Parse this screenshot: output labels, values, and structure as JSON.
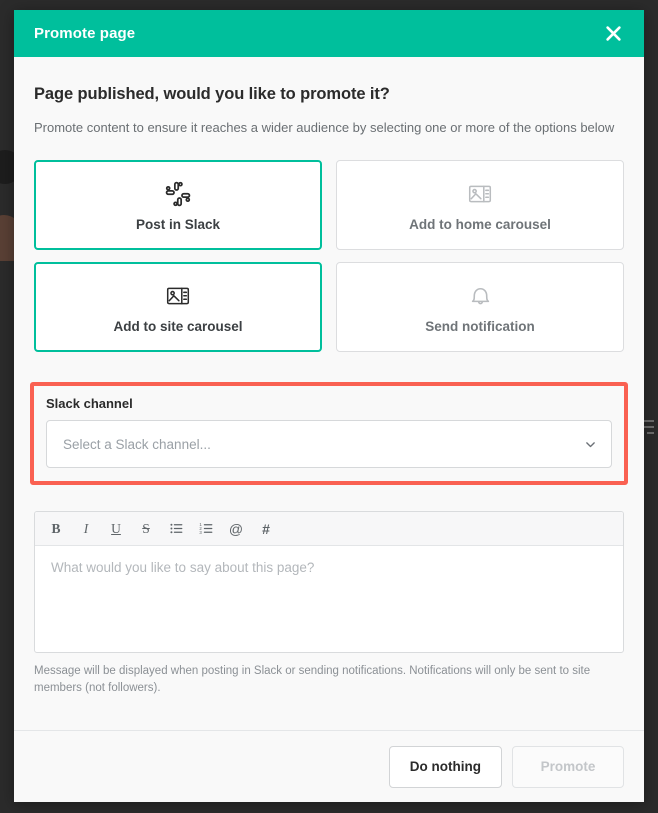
{
  "header": {
    "title": "Promote page",
    "close_icon": "close-icon"
  },
  "body": {
    "headline": "Page published, would you like to promote it?",
    "subtext": "Promote content to ensure it reaches a wider audience by selecting one or more of the options below"
  },
  "options": [
    {
      "label": "Post in Slack",
      "icon": "slack-icon",
      "selected": true
    },
    {
      "label": "Add to home carousel",
      "icon": "carousel-icon",
      "selected": false
    },
    {
      "label": "Add to site carousel",
      "icon": "carousel-icon",
      "selected": true
    },
    {
      "label": "Send notification",
      "icon": "bell-icon",
      "selected": false
    }
  ],
  "slack_channel": {
    "label": "Slack channel",
    "placeholder": "Select a Slack channel...",
    "chevron_icon": "chevron-down-icon",
    "highlight_color": "#fa6152"
  },
  "editor": {
    "placeholder": "What would you like to say about this page?",
    "toolbar": [
      {
        "name": "bold-icon",
        "glyph": "B"
      },
      {
        "name": "italic-icon",
        "glyph": "I"
      },
      {
        "name": "underline-icon",
        "glyph": "U"
      },
      {
        "name": "strikethrough-icon",
        "glyph": "S"
      },
      {
        "name": "bullet-list-icon",
        "glyph": ""
      },
      {
        "name": "numbered-list-icon",
        "glyph": ""
      },
      {
        "name": "mention-icon",
        "glyph": "@"
      },
      {
        "name": "hashtag-icon",
        "glyph": "#"
      }
    ],
    "helper_text": "Message will be displayed when posting in Slack or sending notifications. Notifications will only be sent to site members (not followers)."
  },
  "footer": {
    "secondary_label": "Do nothing",
    "primary_label": "Promote",
    "primary_disabled": true
  },
  "colors": {
    "accent": "#00bf9c",
    "highlight": "#fa6152",
    "backdrop": "#2b2b2b"
  }
}
